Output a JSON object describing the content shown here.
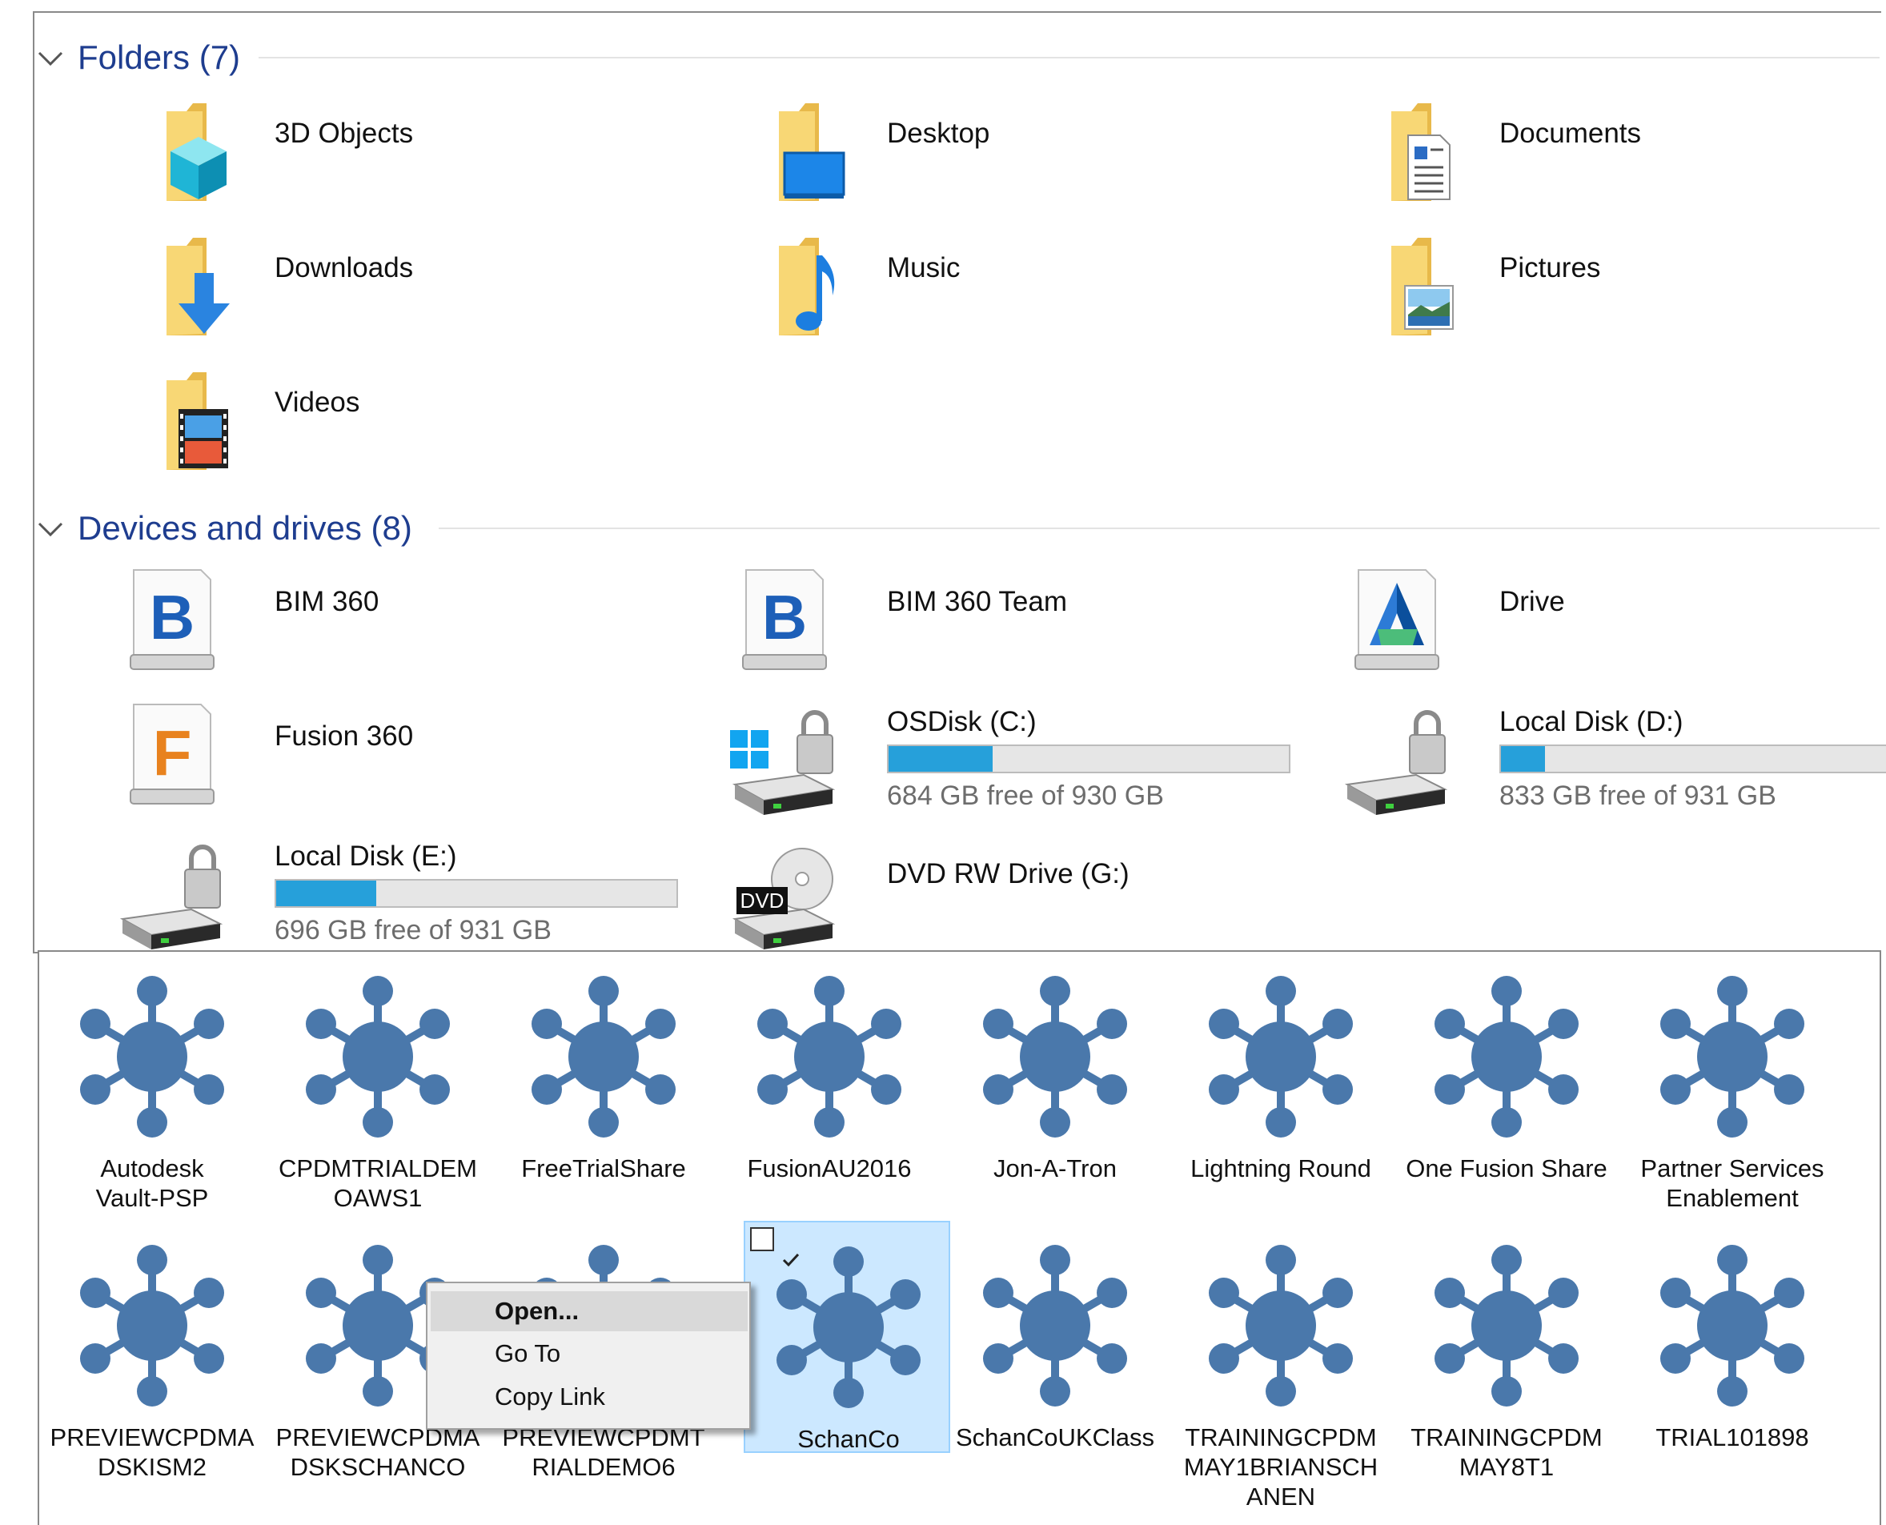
{
  "folders_group": {
    "title": "Folders (7)",
    "items": [
      {
        "name": "3D Objects",
        "icon": "3d-objects-folder-icon"
      },
      {
        "name": "Desktop",
        "icon": "desktop-folder-icon"
      },
      {
        "name": "Documents",
        "icon": "documents-folder-icon"
      },
      {
        "name": "Downloads",
        "icon": "downloads-folder-icon"
      },
      {
        "name": "Music",
        "icon": "music-folder-icon"
      },
      {
        "name": "Pictures",
        "icon": "pictures-folder-icon"
      },
      {
        "name": "Videos",
        "icon": "videos-folder-icon"
      }
    ]
  },
  "devices_group": {
    "title": "Devices and drives (8)",
    "items": [
      {
        "name": "BIM 360",
        "icon": "bim360-drive-icon"
      },
      {
        "name": "BIM 360 Team",
        "icon": "bim360-team-drive-icon"
      },
      {
        "name": "Drive",
        "icon": "autodesk-drive-icon"
      },
      {
        "name": "Fusion 360",
        "icon": "fusion360-drive-icon"
      },
      {
        "name": "OSDisk (C:)",
        "icon": "os-disk-icon",
        "free_text": "684 GB free of 930 GB",
        "used_fraction": 0.26
      },
      {
        "name": "Local Disk (D:)",
        "icon": "local-disk-icon",
        "free_text": "833 GB free of 931 GB",
        "used_fraction": 0.11
      },
      {
        "name": "Local Disk (E:)",
        "icon": "local-disk-icon",
        "free_text": "696 GB free of 931 GB",
        "used_fraction": 0.25
      },
      {
        "name": "DVD RW Drive (G:)",
        "icon": "dvd-drive-icon",
        "badge": "DVD"
      }
    ]
  },
  "shares": [
    "Autodesk\nVault-PSP",
    "CPDMTRIALDEM\nOAWS1",
    "FreeTrialShare",
    "FusionAU2016",
    "Jon-A-Tron",
    "Lightning Round",
    "One Fusion Share",
    "Partner Services\nEnablement",
    "PREVIEWCPDMA\nDSKISM2",
    "PREVIEWCPDMA\nDSKSCHANCO",
    "PREVIEWCPDMT\nRIALDEMO6",
    "SchanCo",
    "SchanCoUKClass",
    "TRAININGCPDM\nMAY1BRIANSCH\nANEN",
    "TRAININGCPDM\nMAY8T1",
    "TRIAL101898"
  ],
  "selected_share": "SchanCo",
  "context_menu": {
    "items": [
      "Open...",
      "Go To",
      "Copy Link"
    ]
  },
  "colors": {
    "group_title": "#1e3d8f",
    "usage_bar": "#26a0da",
    "share_icon": "#4a78ab",
    "selection": "#cce8ff"
  }
}
